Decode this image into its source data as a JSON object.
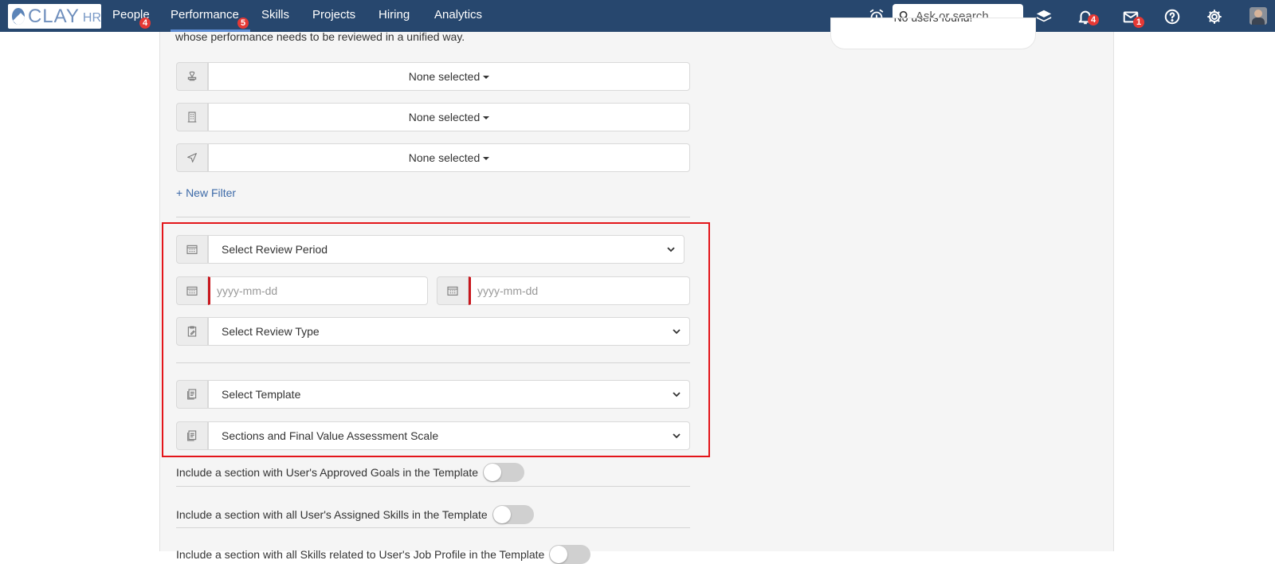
{
  "brand": {
    "clay": "CLAY",
    "hr": "HR"
  },
  "nav": {
    "items": [
      {
        "label": "People",
        "badge": "4"
      },
      {
        "label": "Performance",
        "badge": "5"
      },
      {
        "label": "Skills"
      },
      {
        "label": "Projects"
      },
      {
        "label": "Hiring"
      },
      {
        "label": "Analytics"
      }
    ],
    "search_placeholder": "Ask or search",
    "notifications_badge": "4",
    "messages_badge": "1"
  },
  "intro_text": "whose performance needs to be reviewed in a unified way.",
  "users_box_text": "No users found!",
  "filters": [
    {
      "icon": "stamp-icon",
      "value": "None selected"
    },
    {
      "icon": "building-icon",
      "value": "None selected"
    },
    {
      "icon": "location-arrow-icon",
      "value": "None selected"
    }
  ],
  "new_filter_label": "+ New Filter",
  "review": {
    "period_label": "Select Review Period",
    "start_placeholder": "yyyy-mm-dd",
    "end_placeholder": "yyyy-mm-dd",
    "type_label": "Select Review Type",
    "template_label": "Select Template",
    "scale_label": "Sections and Final Value Assessment Scale"
  },
  "toggles": [
    {
      "label": "Include a section with User's Approved Goals in the Template",
      "on": false
    },
    {
      "label": "Include a section with all User's Assigned Skills in the Template",
      "on": false
    },
    {
      "label": "Include a section with all Skills related to User's Job Profile in the Template",
      "on": false
    }
  ],
  "colors": {
    "navbar": "#27476e",
    "highlight": "#e3151a",
    "required": "#c8161d",
    "link": "#3d6aa8",
    "badge": "#e53935"
  }
}
